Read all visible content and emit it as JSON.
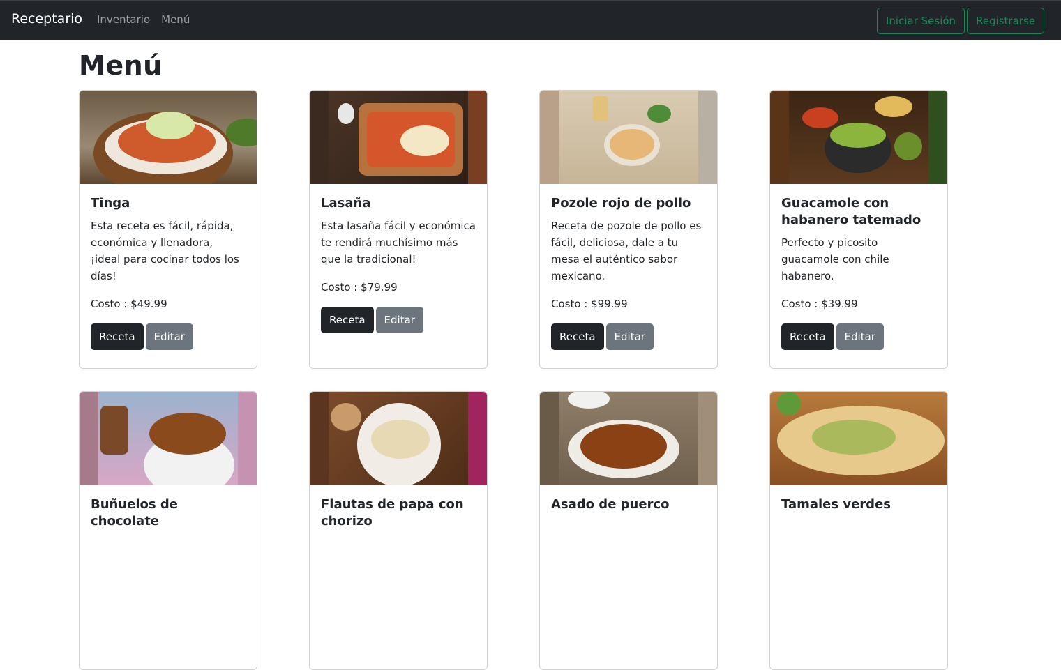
{
  "navbar": {
    "brand": "Receptario",
    "links": [
      "Inventario",
      "Menú"
    ],
    "login": "Iniciar Sesión",
    "register": "Registrarse"
  },
  "page": {
    "title": "Menú"
  },
  "cost_label": "Costo : ",
  "buttons": {
    "recipe": "Receta",
    "edit": "Editar"
  },
  "recipes": [
    {
      "title": "Tinga",
      "description": "Esta receta es fácil, rápida, económica y llenadora, ¡ideal para cocinar todos los días!",
      "cost": "$49.99"
    },
    {
      "title": "Lasaña",
      "description": "Esta lasaña fácil y económica te rendirá muchísimo más que la tradicional!",
      "cost": "$79.99"
    },
    {
      "title": "Pozole rojo de pollo",
      "description": "Receta de pozole de pollo es fácil, deliciosa, dale a tu mesa el auténtico sabor mexicano.",
      "cost": "$99.99"
    },
    {
      "title": "Guacamole con habanero tatemado",
      "description": "Perfecto y picosito guacamole con chile habanero.",
      "cost": "$39.99"
    },
    {
      "title": "Buñuelos de chocolate"
    },
    {
      "title": "Flautas de papa con chorizo"
    },
    {
      "title": "Asado de puerco"
    },
    {
      "title": "Tamales verdes"
    }
  ],
  "colors": {
    "navbar_bg": "#212529",
    "success": "#198754",
    "dark_button": "#212529",
    "secondary_button": "#6c757d"
  }
}
